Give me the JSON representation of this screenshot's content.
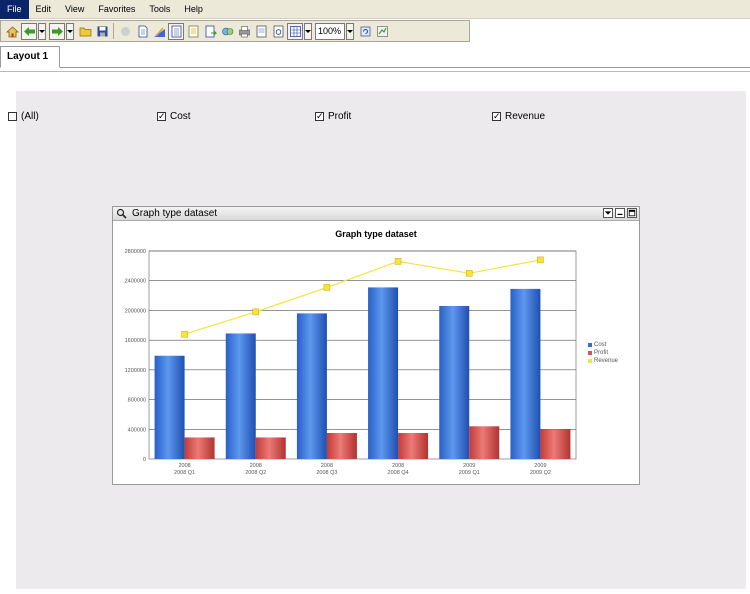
{
  "menu": {
    "items": [
      "File",
      "Edit",
      "View",
      "Favorites",
      "Tools",
      "Help"
    ]
  },
  "toolbar": {
    "icons": [
      "home-icon",
      "back-icon",
      "forward-icon",
      "open-folder-icon",
      "save-icon",
      "disabled-icon",
      "page-icon",
      "chart-edit-icon",
      "report-icon",
      "doc-icon",
      "export-icon",
      "refresh-data-icon",
      "print-icon",
      "page-setup-icon",
      "preview-icon",
      "layout-icon",
      "refresh-icon",
      "settings-icon"
    ],
    "zoom": "100%"
  },
  "tabs": [
    {
      "label": "Layout 1"
    }
  ],
  "filters": [
    {
      "label": "(All)",
      "checked": false
    },
    {
      "label": "Cost",
      "checked": true
    },
    {
      "label": "Profit",
      "checked": true
    },
    {
      "label": "Revenue",
      "checked": true
    }
  ],
  "panel": {
    "title": "Graph type dataset"
  },
  "colors": {
    "cost": "#2f6fd8",
    "profit": "#d9534f",
    "revenue": "#f5e23c",
    "background": "#edeaed"
  },
  "chart_data": {
    "type": "bar",
    "title": "Graph type dataset",
    "categories": [
      [
        "2008",
        "2008 Q1"
      ],
      [
        "2008",
        "2008 Q2"
      ],
      [
        "2008",
        "2008 Q3"
      ],
      [
        "2008",
        "2008 Q4"
      ],
      [
        "2009",
        "2009 Q1"
      ],
      [
        "2009",
        "2009 Q2"
      ]
    ],
    "series": [
      {
        "name": "Cost",
        "type": "bar",
        "values": [
          1390000,
          1690000,
          1960000,
          2310000,
          2060000,
          2290000
        ]
      },
      {
        "name": "Profit",
        "type": "bar",
        "values": [
          290000,
          290000,
          350000,
          350000,
          440000,
          400000
        ]
      },
      {
        "name": "Revenue",
        "type": "line",
        "values": [
          1680000,
          1980000,
          2310000,
          2660000,
          2500000,
          2680000
        ]
      }
    ],
    "yticks": [
      "0",
      "400000",
      "800000",
      "1200000",
      "1600000",
      "2000000",
      "2400000",
      "2800000"
    ],
    "ylim": [
      0,
      2800000
    ],
    "grid": true,
    "legend_position": "right"
  }
}
